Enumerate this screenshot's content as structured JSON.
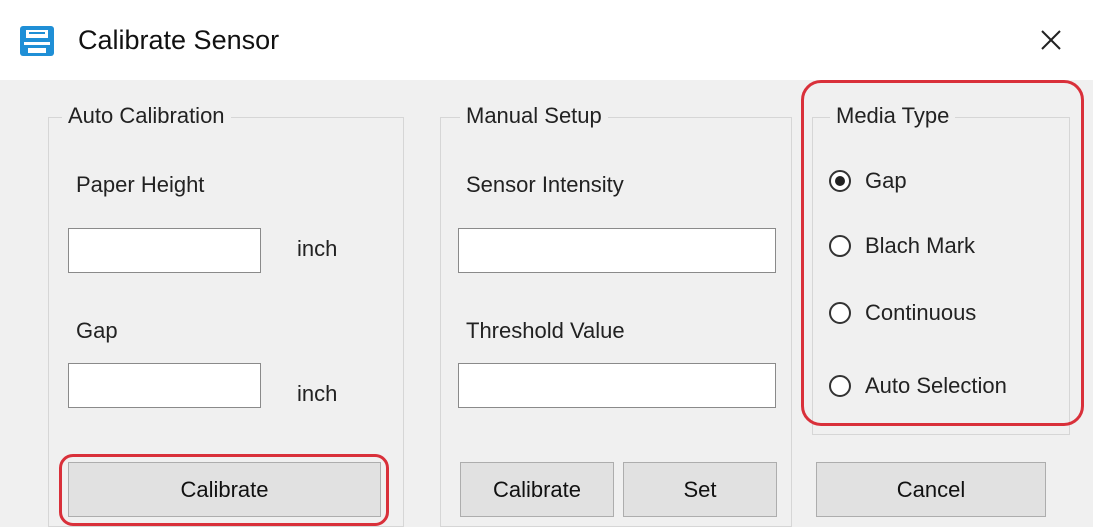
{
  "window": {
    "title": "Calibrate Sensor",
    "icon": "printer-icon",
    "close_icon": "close-icon"
  },
  "auto_calibration": {
    "legend": "Auto Calibration",
    "paper_height_label": "Paper Height",
    "paper_height_value": "",
    "paper_height_unit": "inch",
    "gap_label": "Gap",
    "gap_value": "",
    "gap_unit": "inch",
    "calibrate_label": "Calibrate"
  },
  "manual_setup": {
    "legend": "Manual Setup",
    "sensor_intensity_label": "Sensor Intensity",
    "sensor_intensity_value": "",
    "threshold_label": "Threshold Value",
    "threshold_value": "",
    "calibrate_label": "Calibrate",
    "set_label": "Set"
  },
  "media_type": {
    "legend": "Media Type",
    "options": [
      {
        "label": "Gap",
        "selected": true
      },
      {
        "label": "Blach Mark",
        "selected": false
      },
      {
        "label": "Continuous",
        "selected": false
      },
      {
        "label": "Auto Selection",
        "selected": false
      }
    ],
    "cancel_label": "Cancel"
  },
  "colors": {
    "highlight": "#d9303a",
    "icon_blue": "#1f8fd6"
  }
}
